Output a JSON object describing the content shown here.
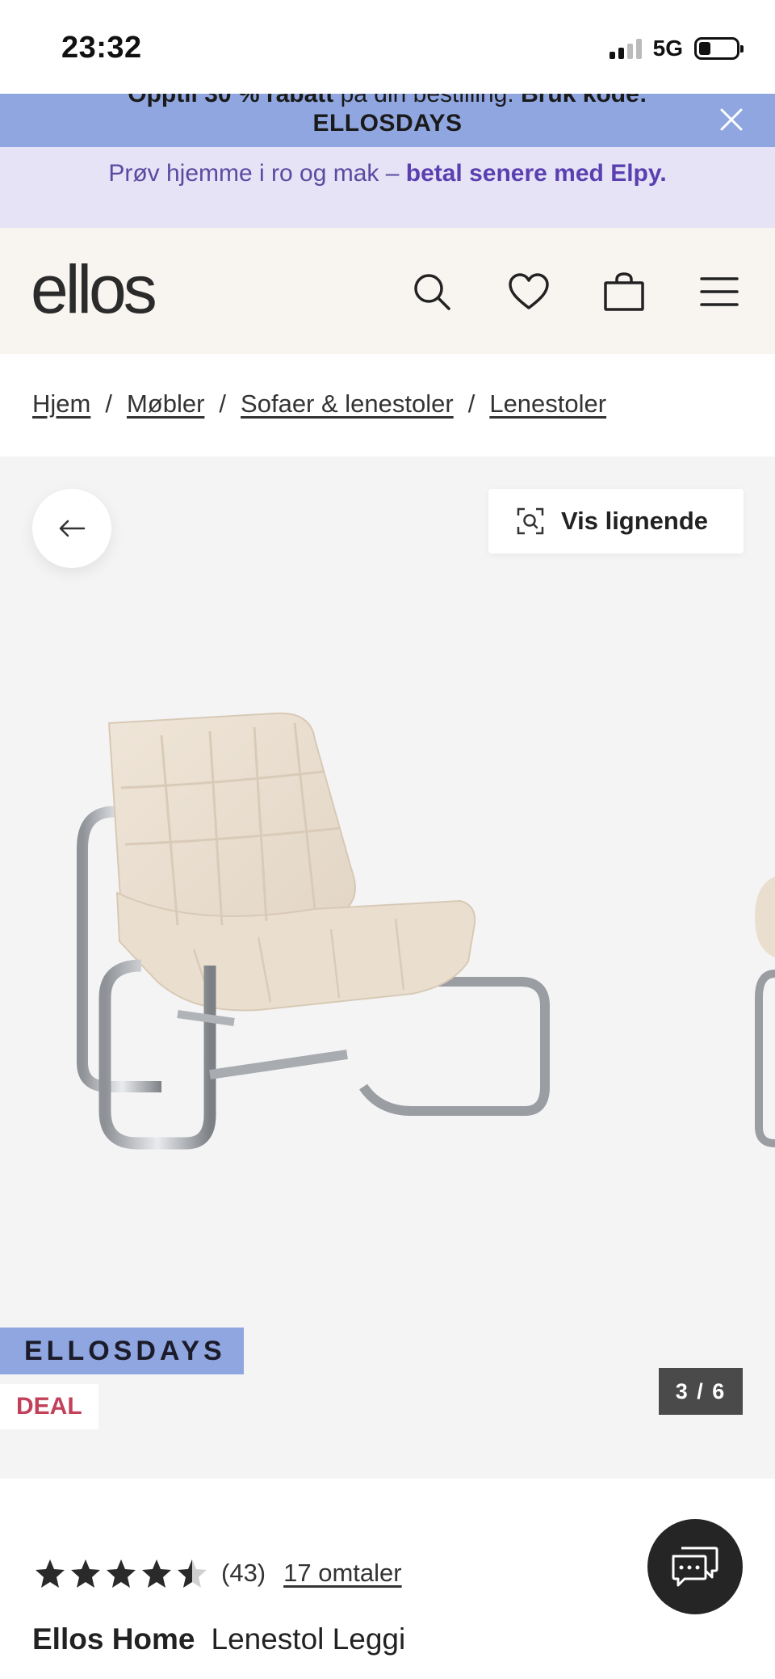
{
  "status_bar": {
    "time": "23:32",
    "network": "5G"
  },
  "promo_banner": {
    "line_prefix": "Opptil 30 % rabatt",
    "line_middle": " på din bestilling. ",
    "line_suffix": "Bruk kode:",
    "code": "ELLOSDAYS",
    "close_label": "Lukk"
  },
  "elpy_banner": {
    "text": "Prøv hjemme i ro og mak – ",
    "bold": "betal senere med Elpy."
  },
  "header": {
    "logo": "ellos"
  },
  "breadcrumb": {
    "items": [
      "Hjem",
      "Møbler",
      "Sofaer & lenestoler",
      "Lenestoler"
    ],
    "separator": "/"
  },
  "gallery": {
    "similar_label": "Vis lignende",
    "campaign_badge": "ELLOSDAYS",
    "deal_badge": "DEAL",
    "counter": "3 / 6"
  },
  "product": {
    "rating": 4.5,
    "rating_count": "(43)",
    "reviews_link": "17 omtaler",
    "brand": "Ellos Home",
    "name": "Lenestol Leggi"
  },
  "colors": {
    "promo_bg": "#8fa6e0",
    "elpy_bg": "#e6e3f6",
    "elpy_text": "#5a3fb0",
    "header_bg": "#f8f5f1",
    "deal_red": "#c2405a",
    "gallery_bg": "#f4f4f4"
  }
}
